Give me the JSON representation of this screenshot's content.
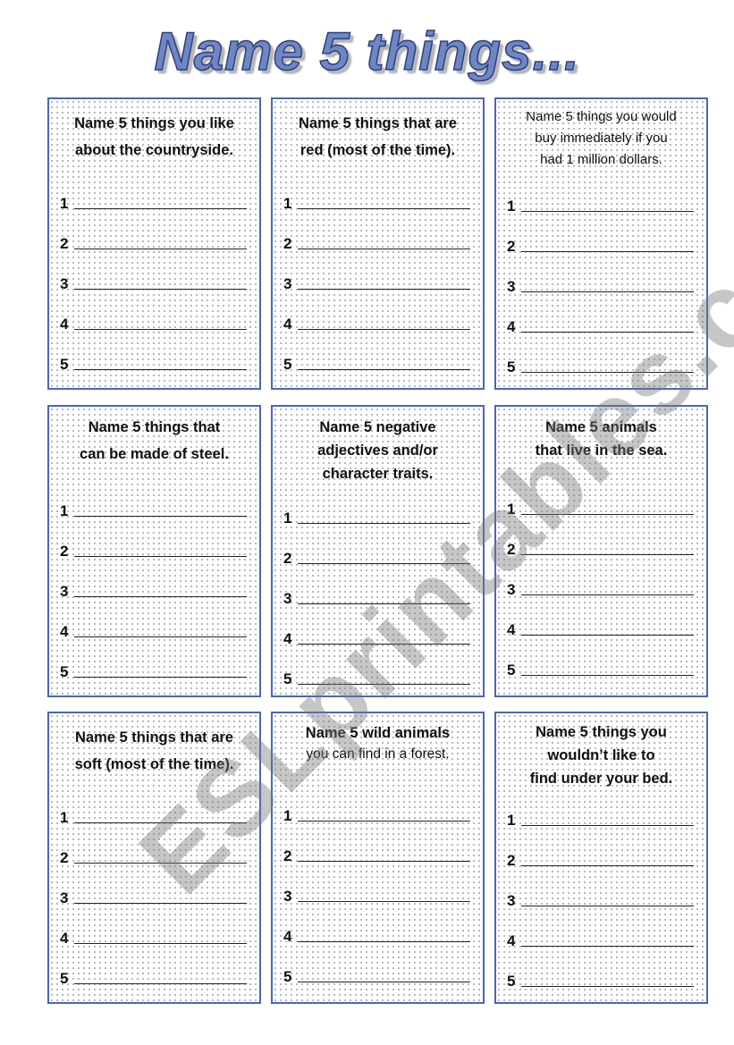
{
  "title": "Name 5 things...",
  "watermark": "ESLprintables.com",
  "colors": {
    "border": "#4a66b8",
    "title_fill": "#6f86c4",
    "title_stroke": "#2c3f80"
  },
  "cards": [
    {
      "prompt_line1": "Name 5 things you like",
      "prompt_line2": "about the countryside.",
      "prompt_line3": "",
      "numbers": [
        "1",
        "2",
        "3",
        "4",
        "5"
      ]
    },
    {
      "prompt_line1": "Name 5 things that are",
      "prompt_line2": "red (most of the time).",
      "prompt_line3": "",
      "numbers": [
        "1",
        "2",
        "3",
        "4",
        "5"
      ]
    },
    {
      "prompt_line1": "Name 5 things you would",
      "prompt_line2": "buy immediately if you",
      "prompt_line3": "had 1 million dollars.",
      "numbers": [
        "1",
        "2",
        "3",
        "4",
        "5"
      ]
    },
    {
      "prompt_line1": "Name 5 things that",
      "prompt_line2": "can be made of steel.",
      "prompt_line3": "",
      "numbers": [
        "1",
        "2",
        "3",
        "4",
        "5"
      ]
    },
    {
      "prompt_line1": "Name 5 negative",
      "prompt_line2": "adjectives and/or",
      "prompt_line3": "character traits.",
      "numbers": [
        "1",
        "2",
        "3",
        "4",
        "5"
      ]
    },
    {
      "prompt_line1": "Name 5 animals",
      "prompt_line2": "that live in the sea.",
      "prompt_line3": "",
      "numbers": [
        "1",
        "2",
        "3",
        "4",
        "5"
      ]
    },
    {
      "prompt_line1": "Name 5 things that are",
      "prompt_line2": "soft (most of the time).",
      "prompt_line3": "",
      "numbers": [
        "1",
        "2",
        "3",
        "4",
        "5"
      ]
    },
    {
      "prompt_line1": "Name 5 wild animals",
      "prompt_line2": "you can find in a forest.",
      "prompt_line3": "",
      "numbers": [
        "1",
        "2",
        "3",
        "4",
        "5"
      ]
    },
    {
      "prompt_line1": "Name 5 things you",
      "prompt_line2": "wouldn’t like to",
      "prompt_line3": "find under your bed.",
      "numbers": [
        "1",
        "2",
        "3",
        "4",
        "5"
      ]
    }
  ]
}
